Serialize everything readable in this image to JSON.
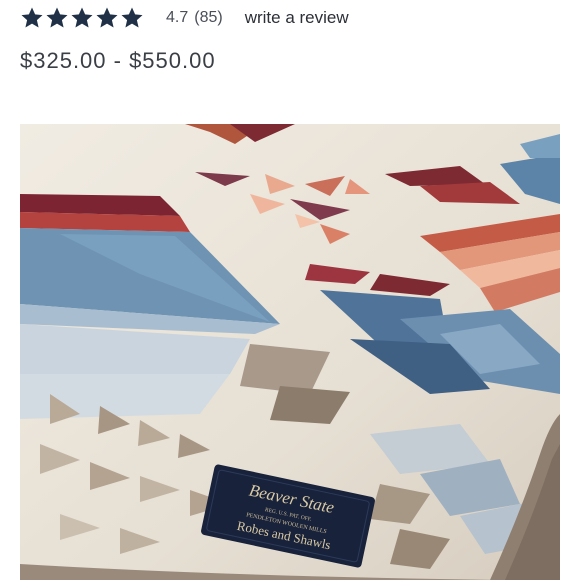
{
  "rating": {
    "stars": 5,
    "star_color": "#1f3047",
    "value": "4.7",
    "count": "(85)",
    "review_link": "write a review"
  },
  "product": {
    "price_range": "$325.00 - $550.00",
    "image_icon": "product-photo",
    "label": {
      "brand": "Beaver State",
      "line1": "REG. U.S. PAT. OFF.",
      "line2": "PENDLETON WOOLEN MILLS",
      "line3": "Robes and Shawls"
    }
  }
}
